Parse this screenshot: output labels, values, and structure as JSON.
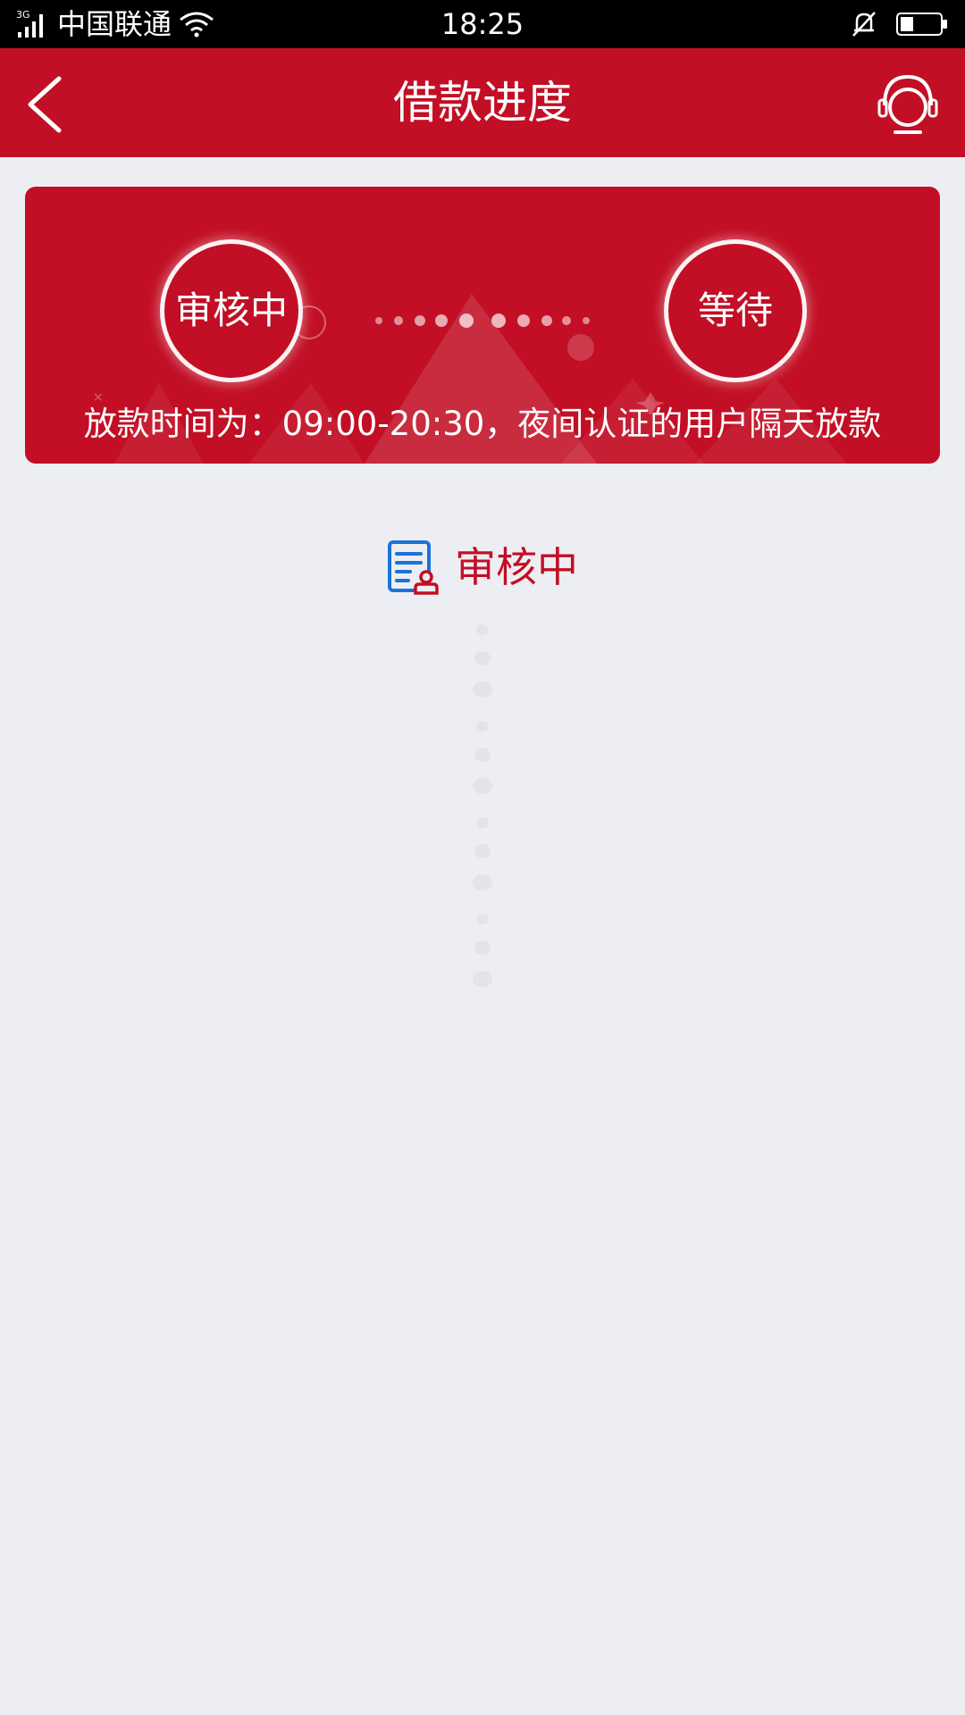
{
  "status_bar": {
    "network": "3G",
    "carrier": "中国联通",
    "time": "18:25"
  },
  "header": {
    "title": "借款进度",
    "back_icon": "chevron-left-icon",
    "support_icon": "headset-icon"
  },
  "progress": {
    "steps": [
      {
        "label": "审核中",
        "state": "active"
      },
      {
        "label": "等待",
        "state": "pending"
      }
    ],
    "note": "放款时间为：09:00-20:30，夜间认证的用户隔天放款"
  },
  "status": {
    "icon": "document-review-icon",
    "text": "审核中"
  },
  "colors": {
    "brand_red": "#c20f25",
    "page_bg": "#edeef3",
    "icon_blue": "#1a73d9"
  }
}
